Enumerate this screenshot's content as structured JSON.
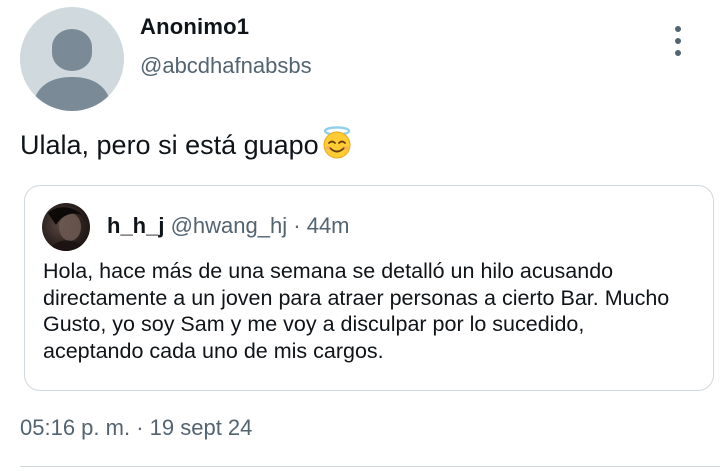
{
  "author": {
    "display_name": "Anonimo1",
    "handle": "@abcdhafnabsbs",
    "avatar_icon": "default-profile-icon"
  },
  "tweet": {
    "text": "Ulala, pero si está guapo",
    "emoji": "😇",
    "emoji_icon": "smiling-face-with-halo-emoji"
  },
  "quoted_tweet": {
    "display_name": "h_h_j",
    "handle": "@hwang_hj",
    "separator": "·",
    "time_ago": "44m",
    "text": "Hola, hace más de una semana se detalló un hilo acusando directamente a un joven para atraer personas a cierto Bar. Mucho Gusto, yo soy Sam y me voy a disculpar por lo sucedido, aceptando cada uno de mis cargos."
  },
  "meta": {
    "time": "05:16 p. m.",
    "separator": "·",
    "date": "19 sept 24"
  },
  "colors": {
    "text_primary": "#0f1419",
    "text_secondary": "#536471",
    "border": "#cfd9de",
    "avatar_bg": "#cfd9de",
    "avatar_fg": "#7b8a97"
  }
}
